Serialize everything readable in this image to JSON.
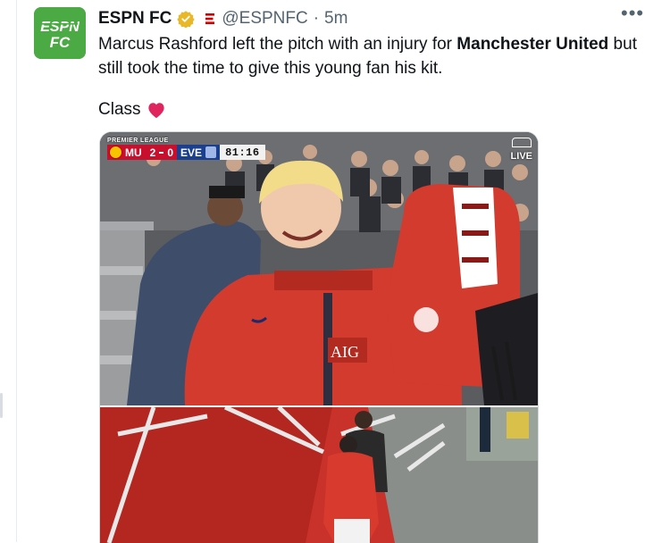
{
  "tweet": {
    "display_name": "ESPN FC",
    "handle": "@ESPNFC",
    "separator": "·",
    "time": "5m",
    "more_label": "•••",
    "avatar_text_top": "ESPN",
    "avatar_text_bottom": "FC",
    "text_part1": "Marcus Rashford left the pitch with an injury for ",
    "text_bold": "Manchester United",
    "text_part2": " but still took the time to give this young fan his kit.",
    "class_text": "Class",
    "heart_icon": "red-heart-icon"
  },
  "scorebug": {
    "competition": "PREMIER LEAGUE",
    "home": "MU",
    "home_score": "2",
    "away_score": "0",
    "away": "EVE",
    "clock": "81:16"
  },
  "broadcast": {
    "live_label": "LIVE"
  },
  "colors": {
    "avatar_bg": "#4caa45",
    "verified_gold": "#e8b829",
    "affiliate_red": "#d00000",
    "heart_red": "#e0245e",
    "united_red": "#c8102e",
    "everton_blue": "#1b3f8f"
  }
}
